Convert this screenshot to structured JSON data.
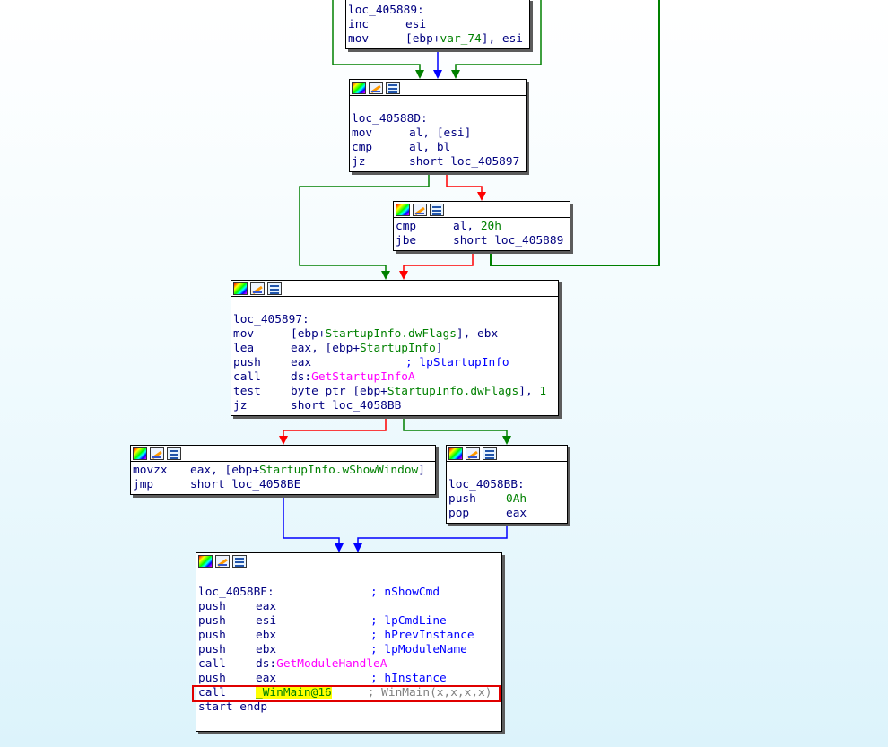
{
  "nodes": {
    "n1": {
      "label": "loc_405889:",
      "l1_mn": "inc",
      "l1_op": "esi",
      "l2_mn": "mov",
      "l2_a": "[ebp+",
      "l2_var": "var_74",
      "l2_b": "], esi"
    },
    "n2": {
      "label": "loc_40588D:",
      "l1_mn": "mov",
      "l1_op": "al, [esi]",
      "l2_mn": "cmp",
      "l2_op": "al, bl",
      "l3_mn": "jz",
      "l3_op": "short loc_405897"
    },
    "n3": {
      "l1_mn": "cmp",
      "l1_a": "al, ",
      "l1_num": "20h",
      "l2_mn": "jbe",
      "l2_op": "short loc_405889"
    },
    "n4": {
      "label": "loc_405897:",
      "l1_mn": "mov",
      "l1_a": "[ebp+",
      "l1_v": "StartupInfo.dwFlags",
      "l1_b": "], ebx",
      "l2_mn": "lea",
      "l2_a": "eax, [ebp+",
      "l2_v": "StartupInfo",
      "l2_b": "]",
      "l3_mn": "push",
      "l3_op": "eax",
      "l3_cm": "; lpStartupInfo",
      "l4_mn": "call",
      "l4_a": "ds:",
      "l4_fn": "GetStartupInfoA",
      "l5_mn": "test",
      "l5_a": "byte ptr [ebp+",
      "l5_v": "StartupInfo.dwFlags",
      "l5_b": "], ",
      "l5_num": "1",
      "l6_mn": "jz",
      "l6_op": "short loc_4058BB"
    },
    "n5": {
      "l1_mn": "movzx",
      "l1_a": "eax, [ebp+",
      "l1_v": "StartupInfo.wShowWindow",
      "l1_b": "]",
      "l2_mn": "jmp",
      "l2_op": "short loc_4058BE"
    },
    "n6": {
      "label": "loc_4058BB:",
      "l1_mn": "push",
      "l1_num": "0Ah",
      "l2_mn": "pop",
      "l2_op": "eax"
    },
    "n7": {
      "label": "loc_4058BE:",
      "label_cm": "; nShowCmd",
      "l1_mn": "push",
      "l1_op": "eax",
      "l2_mn": "push",
      "l2_op": "esi",
      "l2_cm": "; lpCmdLine",
      "l3_mn": "push",
      "l3_op": "ebx",
      "l3_cm": "; hPrevInstance",
      "l4_mn": "push",
      "l4_op": "ebx",
      "l4_cm": "; lpModuleName",
      "l5_mn": "call",
      "l5_a": "ds:",
      "l5_fn": "GetModuleHandleA",
      "l6_mn": "push",
      "l6_op": "eax",
      "l6_cm": "; hInstance",
      "l7_mn": "call",
      "l7_fn": "_WinMain@16",
      "l7_cm": "; WinMain(x,x,x,x)",
      "l8": "start endp"
    }
  },
  "colors": {
    "true_edge": "#008000",
    "false_edge": "#ff0000",
    "uncond_edge": "#0000ff",
    "highlight": "#ffff00",
    "selection": "#e00000"
  },
  "icons": [
    "color-icon",
    "edit-node-icon",
    "graph-icon"
  ]
}
